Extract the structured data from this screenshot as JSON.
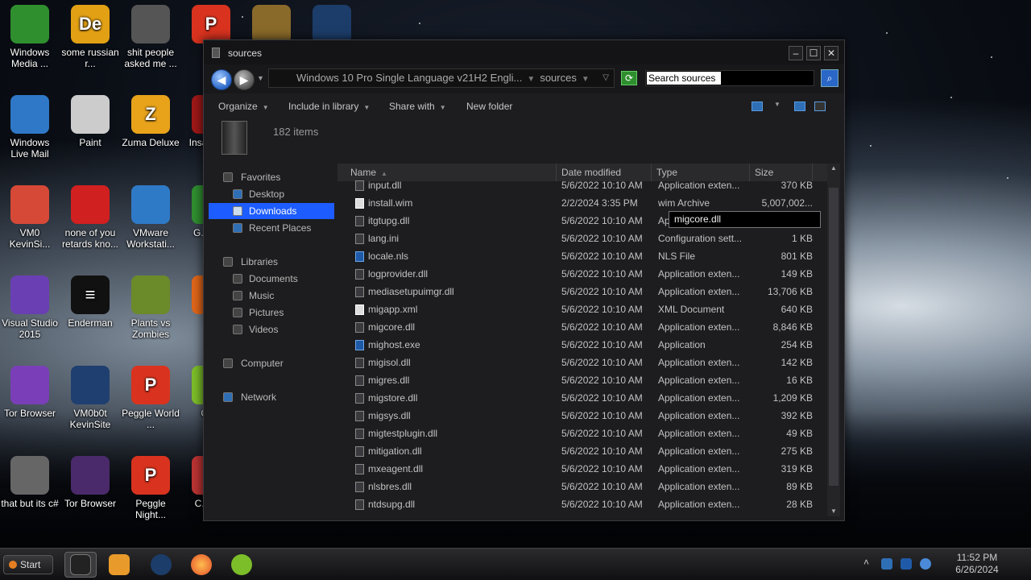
{
  "desktop": {
    "icons": [
      {
        "label": "Windows Media ...",
        "color": "#2f8f2f"
      },
      {
        "label": "some russian r...",
        "color": "#e2a014",
        "glyph": "De"
      },
      {
        "label": "shit people asked me ...",
        "color": "#555"
      },
      {
        "label": "P...",
        "color": "#d9331f",
        "glyph": "P"
      },
      {
        "label": "",
        "color": "#8a6a2a"
      },
      {
        "label": "",
        "color": "#1c3d6a"
      },
      {
        "label": "Windows Live Mail",
        "color": "#2f78c7"
      },
      {
        "label": "Paint",
        "color": "#ccc"
      },
      {
        "label": "Zuma Deluxe",
        "color": "#e8a31b",
        "glyph": "Z"
      },
      {
        "label": "Insa... D...",
        "color": "#a01818"
      },
      {
        "label": "VM0 KevinSi...",
        "color": "#d64937"
      },
      {
        "label": "none of you retards kno...",
        "color": "#d12020"
      },
      {
        "label": "VMware Workstati...",
        "color": "#2f7ac7"
      },
      {
        "label": "G... Cl...",
        "color": "#2f8f2f"
      },
      {
        "label": "Visual Studio 2015",
        "color": "#6a3fb4"
      },
      {
        "label": "Enderman",
        "color": "#111",
        "glyph": "≡"
      },
      {
        "label": "Plants vs Zombies",
        "color": "#6b8a2a"
      },
      {
        "label": "F...",
        "color": "#e0661a"
      },
      {
        "label": "Tor Browser",
        "color": "#7a3fb8"
      },
      {
        "label": "VM0b0t KevinSite",
        "color": "#1e3f6f"
      },
      {
        "label": "Peggle World ...",
        "color": "#d9331f",
        "glyph": "P"
      },
      {
        "label": "Co...",
        "color": "#7cbd2a"
      },
      {
        "label": "that but its c#",
        "color": "#666"
      },
      {
        "label": "Tor Browser",
        "color": "#4a2a6a"
      },
      {
        "label": "Peggle Night...",
        "color": "#d9331f",
        "glyph": "P"
      },
      {
        "label": "C... D...",
        "color": "#b33"
      }
    ]
  },
  "window": {
    "title": "sources",
    "controls": {
      "minimize": "–",
      "maximize": "☐",
      "close": "✕"
    },
    "breadcrumb": [
      "Windows 10 Pro Single Language v21H2 Engli...",
      "sources"
    ],
    "search_placeholder": "Search sources",
    "commands": [
      "Organize",
      "Include in library",
      "Share with",
      "New folder"
    ],
    "item_count": "182 items",
    "nav": {
      "favorites": "Favorites",
      "desktop": "Desktop",
      "downloads": "Downloads",
      "recent": "Recent Places",
      "libraries": "Libraries",
      "documents": "Documents",
      "music": "Music",
      "pictures": "Pictures",
      "videos": "Videos",
      "computer": "Computer",
      "network": "Network"
    },
    "columns": {
      "name": "Name",
      "date": "Date modified",
      "type": "Type",
      "size": "Size"
    },
    "files": [
      {
        "name": "input.dll",
        "date": "5/6/2022 10:10 AM",
        "type": "Application exten...",
        "size": "370 KB",
        "icon": "dll"
      },
      {
        "name": "install.wim",
        "date": "2/2/2024 3:35 PM",
        "type": "wim Archive",
        "size": "5,007,002...",
        "icon": "light"
      },
      {
        "name": "itgtupg.dll",
        "date": "5/6/2022 10:10 AM",
        "type": "Ap",
        "size": "",
        "icon": "dll"
      },
      {
        "name": "lang.ini",
        "date": "5/6/2022 10:10 AM",
        "type": "Configuration sett...",
        "size": "1 KB",
        "icon": "dll"
      },
      {
        "name": "locale.nls",
        "date": "5/6/2022 10:10 AM",
        "type": "NLS File",
        "size": "801 KB",
        "icon": "blue"
      },
      {
        "name": "logprovider.dll",
        "date": "5/6/2022 10:10 AM",
        "type": "Application exten...",
        "size": "149 KB",
        "icon": "dll"
      },
      {
        "name": "mediasetupuimgr.dll",
        "date": "5/6/2022 10:10 AM",
        "type": "Application exten...",
        "size": "13,706 KB",
        "icon": "dll"
      },
      {
        "name": "migapp.xml",
        "date": "5/6/2022 10:10 AM",
        "type": "XML Document",
        "size": "640 KB",
        "icon": "light"
      },
      {
        "name": "migcore.dll",
        "date": "5/6/2022 10:10 AM",
        "type": "Application exten...",
        "size": "8,846 KB",
        "icon": "dll"
      },
      {
        "name": "mighost.exe",
        "date": "5/6/2022 10:10 AM",
        "type": "Application",
        "size": "254 KB",
        "icon": "blue"
      },
      {
        "name": "migisol.dll",
        "date": "5/6/2022 10:10 AM",
        "type": "Application exten...",
        "size": "142 KB",
        "icon": "dll"
      },
      {
        "name": "migres.dll",
        "date": "5/6/2022 10:10 AM",
        "type": "Application exten...",
        "size": "16 KB",
        "icon": "dll"
      },
      {
        "name": "migstore.dll",
        "date": "5/6/2022 10:10 AM",
        "type": "Application exten...",
        "size": "1,209 KB",
        "icon": "dll"
      },
      {
        "name": "migsys.dll",
        "date": "5/6/2022 10:10 AM",
        "type": "Application exten...",
        "size": "392 KB",
        "icon": "dll"
      },
      {
        "name": "migtestplugin.dll",
        "date": "5/6/2022 10:10 AM",
        "type": "Application exten...",
        "size": "49 KB",
        "icon": "dll"
      },
      {
        "name": "mitigation.dll",
        "date": "5/6/2022 10:10 AM",
        "type": "Application exten...",
        "size": "275 KB",
        "icon": "dll"
      },
      {
        "name": "mxeagent.dll",
        "date": "5/6/2022 10:10 AM",
        "type": "Application exten...",
        "size": "319 KB",
        "icon": "dll"
      },
      {
        "name": "nlsbres.dll",
        "date": "5/6/2022 10:10 AM",
        "type": "Application exten...",
        "size": "89 KB",
        "icon": "dll"
      },
      {
        "name": "ntdsupg.dll",
        "date": "5/6/2022 10:10 AM",
        "type": "Application exten...",
        "size": "28 KB",
        "icon": "dll"
      }
    ],
    "tooltip": "migcore.dll"
  },
  "taskbar": {
    "start_label": "Start",
    "clock_time": "11:52 PM",
    "clock_date": "6/26/2024"
  }
}
